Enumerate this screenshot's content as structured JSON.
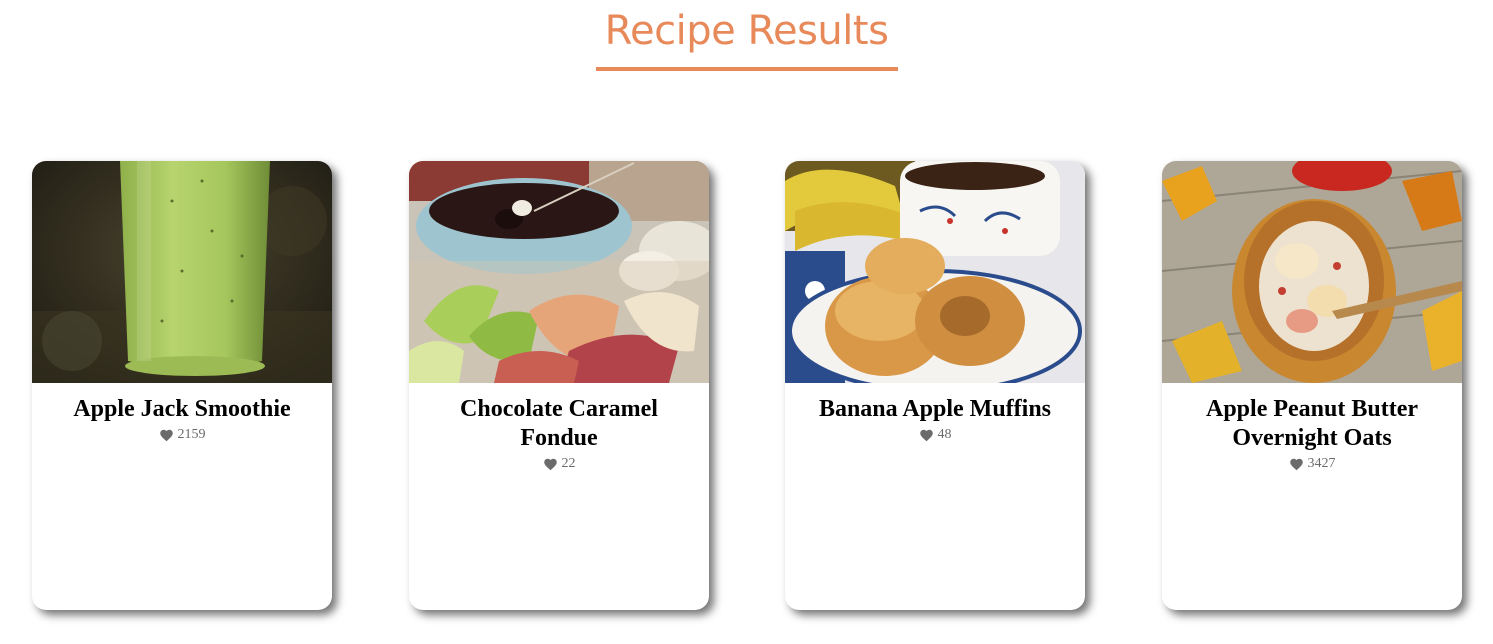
{
  "page": {
    "title": "Recipe Results",
    "accent_color": "#e8895a"
  },
  "recipes": [
    {
      "name": "Apple Jack Smoothie",
      "likes": "2159",
      "image": "green-smoothie-glass"
    },
    {
      "name": "Chocolate Caramel Fondue",
      "likes": "22",
      "image": "chocolate-fondue-with-fruit"
    },
    {
      "name": "Banana Apple Muffins",
      "likes": "48",
      "image": "muffins-on-plate-with-teacup"
    },
    {
      "name": "Apple Peanut Butter Overnight Oats",
      "likes": "3427",
      "image": "oats-jar-with-autumn-leaves"
    }
  ],
  "icons": {
    "likes": "heart-icon"
  }
}
